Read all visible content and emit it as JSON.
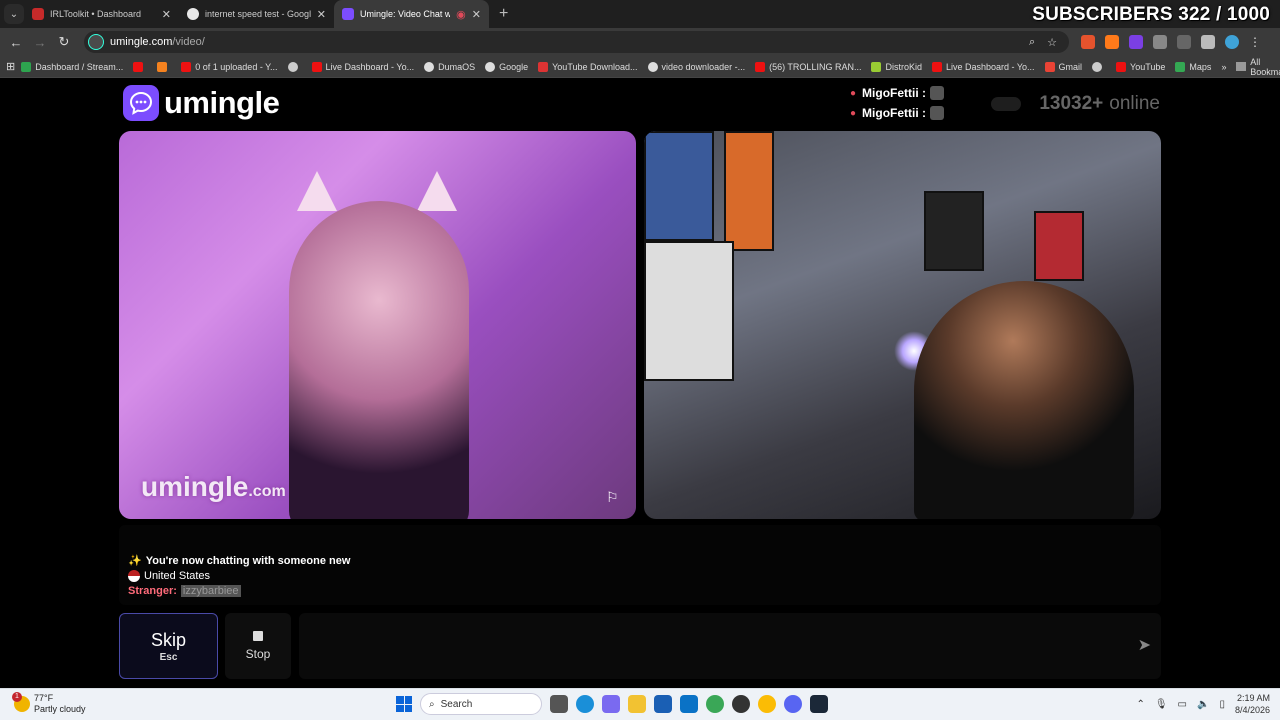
{
  "browser": {
    "tabs": [
      {
        "title": "IRLToolkit • Dashboard",
        "color": "#c72a2a",
        "active": false
      },
      {
        "title": "internet speed test - Google Se",
        "color": "#e8e8e8",
        "active": false
      },
      {
        "title": "Umingle: Video Chat with St",
        "color": "#7c4dff",
        "active": true
      }
    ],
    "new_tab_symbol": "+",
    "url_host": "umingle.com",
    "url_path": "/video/",
    "bookmarks": [
      "Dashboard / Stream...",
      "0 of 1 uploaded - Y...",
      "Live Dashboard - Yo...",
      "DumaOS",
      "Google",
      "YouTube Download...",
      "video downloader -...",
      "(56) TROLLING RAN...",
      "DistroKid",
      "Live Dashboard - Yo...",
      "Gmail",
      "YouTube",
      "Maps"
    ],
    "all_bookmarks": "All Bookmarks"
  },
  "overlay": {
    "subscribers": "SUBSCRIBERS 322 / 1000"
  },
  "site": {
    "logo_text": "umingle",
    "donors": [
      {
        "name": "MigoFettii :"
      },
      {
        "name": "MigoFettii :"
      }
    ],
    "online_count": "13032+",
    "online_label": "online",
    "watermark_main": "umingle",
    "watermark_suffix": ".com",
    "chat": {
      "system_message": "You're now chatting with someone new",
      "country": "United States",
      "stranger_label": "Stranger:",
      "stranger_name": "izzybarbiee"
    },
    "controls": {
      "skip_label": "Skip",
      "skip_hint": "Esc",
      "stop_label": "Stop",
      "message_placeholder": ""
    }
  },
  "taskbar": {
    "weather_temp": "77°F",
    "weather_desc": "Partly cloudy",
    "weather_badge": "1",
    "search_label": "Search",
    "time": "2:19 AM",
    "date": "8/4/2026"
  },
  "colors": {
    "brand": "#7c4dff",
    "stranger": "#ff6b7a",
    "skip_border": "#4a4aa8"
  }
}
